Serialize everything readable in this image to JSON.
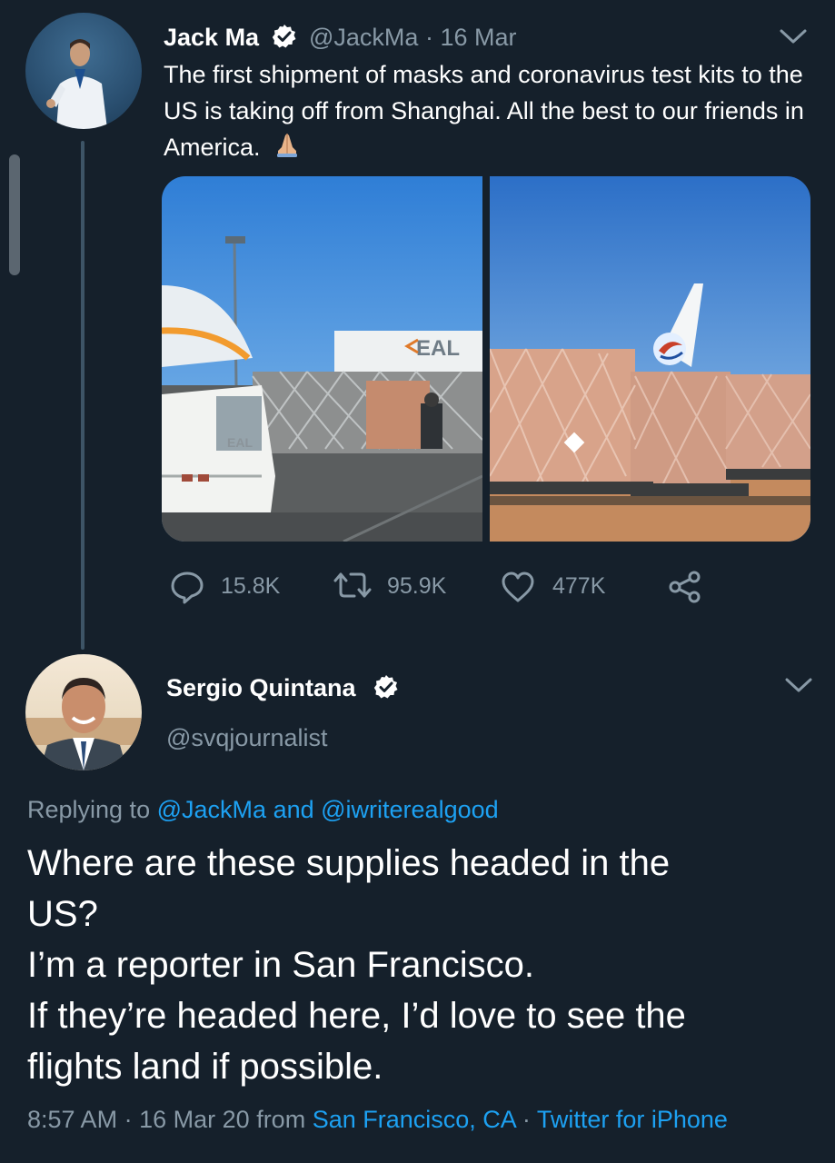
{
  "tweet1": {
    "author_name": "Jack Ma",
    "handle": "@JackMa",
    "separator": "·",
    "date": "16 Mar",
    "text": "The first shipment of masks and coronavirus test kits to the US is taking off from Shanghai. All the best to our friends in America.",
    "emoji": "folded-hands",
    "media_label_left": "EAL",
    "media_label_truck": "EAL",
    "stats": {
      "replies": "15.8K",
      "retweets": "95.9K",
      "likes": "477K"
    }
  },
  "tweet2": {
    "author_name": "Sergio Quintana",
    "handle": "@svqjournalist",
    "replying_prefix": "Replying to",
    "replying_user1": "@JackMa",
    "replying_and": "and",
    "replying_user2": "@iwriterealgood",
    "text_lines": [
      "Where are these supplies headed in the",
      "US?",
      "I’m a reporter in San Francisco.",
      "If they’re headed here, I’d love to see the",
      "flights land if possible."
    ],
    "time": "8:57 AM",
    "sep": "·",
    "date": "16 Mar 20",
    "from": "from",
    "location": "San Francisco, CA",
    "source": "Twitter for iPhone"
  },
  "colors": {
    "background": "#15202b",
    "secondary_text": "#8899a6",
    "link": "#1da1f2",
    "verified": "#ffffff"
  }
}
